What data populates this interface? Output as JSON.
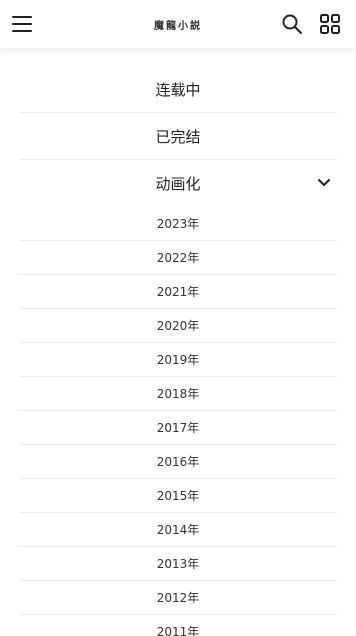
{
  "header": {
    "logo_text": "魔龍小説",
    "menu_icon": "menu-icon",
    "search_icon": "search-icon",
    "grid_icon": "grid-icon"
  },
  "categories": [
    {
      "label": "连载中"
    },
    {
      "label": "已完结"
    },
    {
      "label": "动画化",
      "expanded": true
    }
  ],
  "years": [
    {
      "label": "2023年"
    },
    {
      "label": "2022年"
    },
    {
      "label": "2021年"
    },
    {
      "label": "2020年"
    },
    {
      "label": "2019年"
    },
    {
      "label": "2018年"
    },
    {
      "label": "2017年"
    },
    {
      "label": "2016年"
    },
    {
      "label": "2015年"
    },
    {
      "label": "2014年"
    },
    {
      "label": "2013年"
    },
    {
      "label": "2012年"
    },
    {
      "label": "2011年"
    }
  ]
}
